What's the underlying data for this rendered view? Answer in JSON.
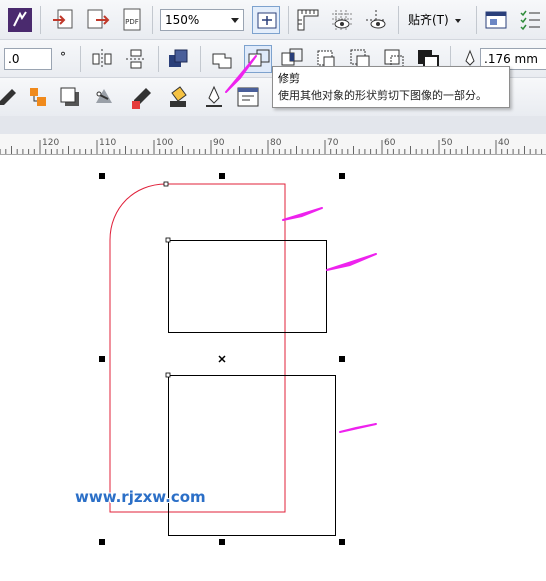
{
  "toolbar": {
    "zoom_value": "150%",
    "snap_label": "贴齐(T)"
  },
  "property_bar": {
    "angle_value": ".0",
    "degree_symbol": "°",
    "outline_width": ".176 mm"
  },
  "tooltip": {
    "title": "修剪",
    "description": "使用其他对象的形状剪切下图像的一部分。"
  },
  "ruler": {
    "labels": [
      "120",
      "110",
      "100",
      "90",
      "80",
      "70",
      "60",
      "50",
      "40"
    ]
  },
  "watermark": "www.rjzxw.com",
  "colors": {
    "selected_outline": "#e0203a",
    "annotation_arrow": "#ee22ee",
    "toolbar_accent": "#2a3f7a"
  }
}
